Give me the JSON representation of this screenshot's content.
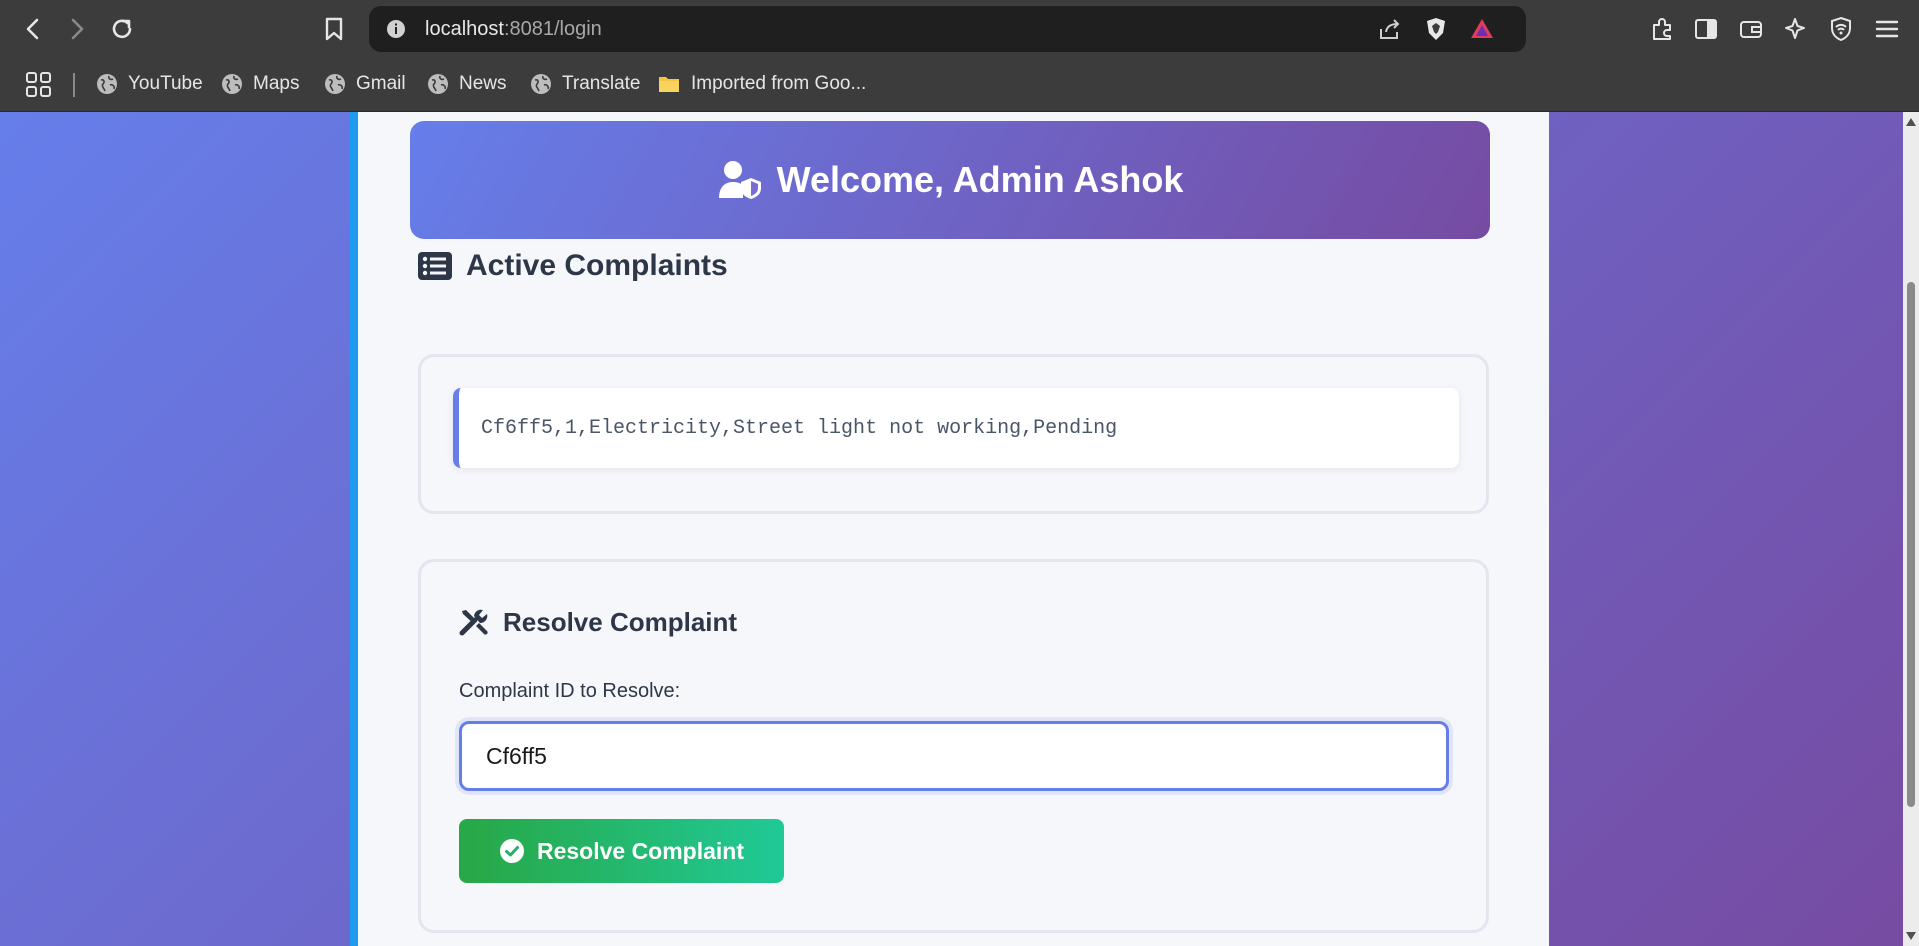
{
  "browser": {
    "url_host": "localhost",
    "url_path": ":8081/login",
    "bookmarks": [
      {
        "label": "YouTube",
        "icon": "globe-icon"
      },
      {
        "label": "Maps",
        "icon": "globe-icon"
      },
      {
        "label": "Gmail",
        "icon": "globe-icon"
      },
      {
        "label": "News",
        "icon": "globe-icon"
      },
      {
        "label": "Translate",
        "icon": "globe-icon"
      },
      {
        "label": "Imported from Goo...",
        "icon": "folder-icon"
      }
    ]
  },
  "page": {
    "welcome_title": "Welcome, Admin Ashok",
    "active_complaints_title": "Active Complaints",
    "complaints": [
      "Cf6ff5,1,Electricity,Street light not working,Pending"
    ],
    "resolve_section_title": "Resolve Complaint",
    "complaint_id_label": "Complaint ID to Resolve:",
    "complaint_id_value": "Cf6ff5",
    "resolve_button_label": "Resolve Complaint"
  },
  "colors": {
    "gradient_start": "#667eea",
    "gradient_end": "#764ba2",
    "success_start": "#28a745",
    "success_end": "#20c997",
    "accent_border": "#1e9bf0"
  }
}
